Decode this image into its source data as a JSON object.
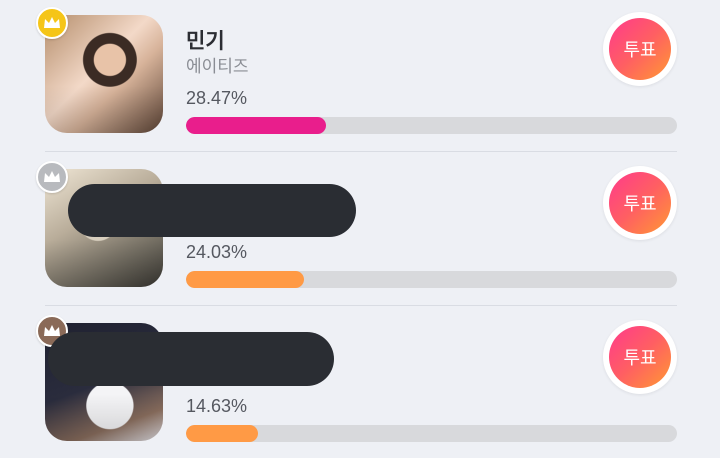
{
  "colors": {
    "rank1_fill": "#e91e8c",
    "other_fill": "#ff9a45",
    "track": "#d8d9dc",
    "crown_gold": "#f5c518",
    "crown_silver": "#b8babe",
    "crown_bronze": "#8a6a58",
    "vote_gradient_start": "#ff3a8c",
    "vote_gradient_end": "#ff9933"
  },
  "ranking": [
    {
      "name": "민기",
      "group": "에이티즈",
      "percent_label": "28.47%",
      "percent": 28.47,
      "vote_label": "투표",
      "crown": "gold-crown-icon"
    },
    {
      "name": "",
      "group": "",
      "percent_label": "24.03%",
      "percent": 24.03,
      "vote_label": "투표",
      "crown": "silver-crown-icon"
    },
    {
      "name": "",
      "group": "",
      "percent_label": "14.63%",
      "percent": 14.63,
      "vote_label": "투표",
      "crown": "bronze-crown-icon"
    }
  ]
}
